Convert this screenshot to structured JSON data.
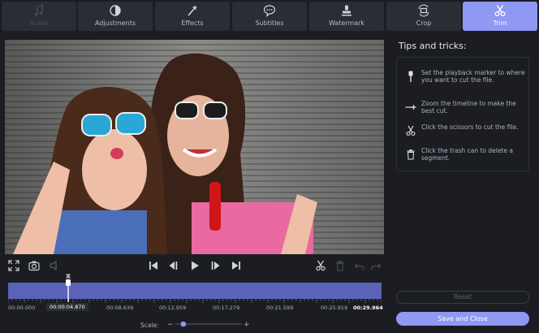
{
  "tabs": [
    {
      "label": "Audio",
      "state": "disabled",
      "icon": "music-note-icon"
    },
    {
      "label": "Adjustments",
      "state": "normal",
      "icon": "contrast-icon"
    },
    {
      "label": "Effects",
      "state": "normal",
      "icon": "magic-wand-icon"
    },
    {
      "label": "Subtitles",
      "state": "normal",
      "icon": "speech-bubble-icon"
    },
    {
      "label": "Watermark",
      "state": "normal",
      "icon": "stamp-icon"
    },
    {
      "label": "Crop",
      "state": "normal",
      "icon": "crop-rotate-icon"
    },
    {
      "label": "Trim",
      "state": "active",
      "icon": "scissors-icon"
    }
  ],
  "tips": {
    "title": "Tips and tricks:",
    "items": [
      {
        "icon": "playback-marker-icon",
        "text": "Set the playback marker to where you want to cut the file."
      },
      {
        "icon": "zoom-timeline-icon",
        "text": "Zoom the timeline to make the best cut."
      },
      {
        "icon": "scissors-icon",
        "text": "Click the scissors to cut the file."
      },
      {
        "icon": "trash-icon",
        "text": "Click the trash can to delete a segment."
      }
    ]
  },
  "buttons": {
    "reset": "Reset",
    "save_close": "Save and Close"
  },
  "timeline": {
    "current_time": "00:00:04.870",
    "timecodes": [
      "00:00.000",
      "00:08.639",
      "00:12.959",
      "00:17.279",
      "00:21.599",
      "00:25.919",
      "00:29.964"
    ],
    "playhead_fraction": 0.16
  },
  "scale": {
    "label": "Scale:",
    "minus": "−",
    "plus": "+",
    "level": 0.12
  },
  "colors": {
    "accent": "#8f98f3",
    "track": "#5b63b8",
    "background": "#1b1d22"
  }
}
